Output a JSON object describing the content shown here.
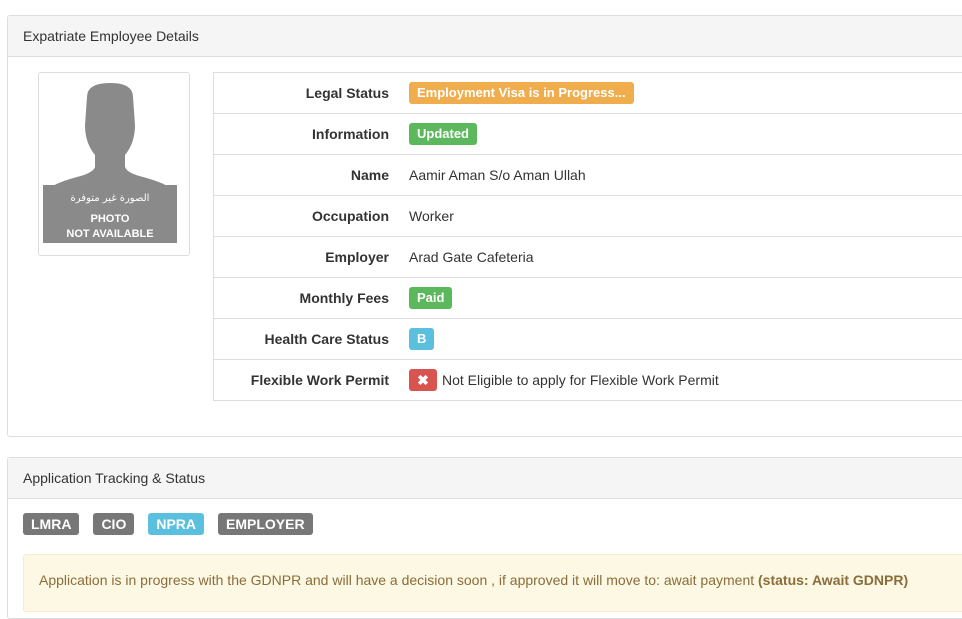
{
  "employee_panel": {
    "title": "Expatriate Employee Details",
    "photo": {
      "arabic_text": "الصورة غير متوفرة",
      "line1": "PHOTO",
      "line2": "NOT AVAILABLE"
    },
    "rows": [
      {
        "label": "Legal Status",
        "value": "Employment Visa is in Progress..."
      },
      {
        "label": "Information",
        "value": "Updated"
      },
      {
        "label": "Name",
        "value": "Aamir Aman S/o Aman Ullah"
      },
      {
        "label": "Occupation",
        "value": "Worker"
      },
      {
        "label": "Employer",
        "value": "Arad Gate Cafeteria"
      },
      {
        "label": "Monthly Fees",
        "value": "Paid"
      },
      {
        "label": "Health Care Status",
        "value": "B"
      },
      {
        "label": "Flexible Work Permit",
        "icon": "x-icon",
        "value": "Not Eligible to apply for Flexible Work Permit"
      }
    ]
  },
  "tracking_panel": {
    "title": "Application Tracking & Status",
    "stages": [
      "LMRA",
      "CIO",
      "NPRA",
      "EMPLOYER"
    ],
    "active_stage": "NPRA",
    "message": "Application is in progress with the GDNPR and will have a decision soon , if approved it will move to: await payment",
    "status_text": "(status: Await GDNPR)"
  },
  "colors": {
    "warning": "#f0ad4e",
    "success": "#5cb85c",
    "info": "#5bc0de",
    "danger": "#d9534f",
    "default": "#777777",
    "alert_bg": "#fcf8e3",
    "alert_text": "#8a6d3b"
  }
}
